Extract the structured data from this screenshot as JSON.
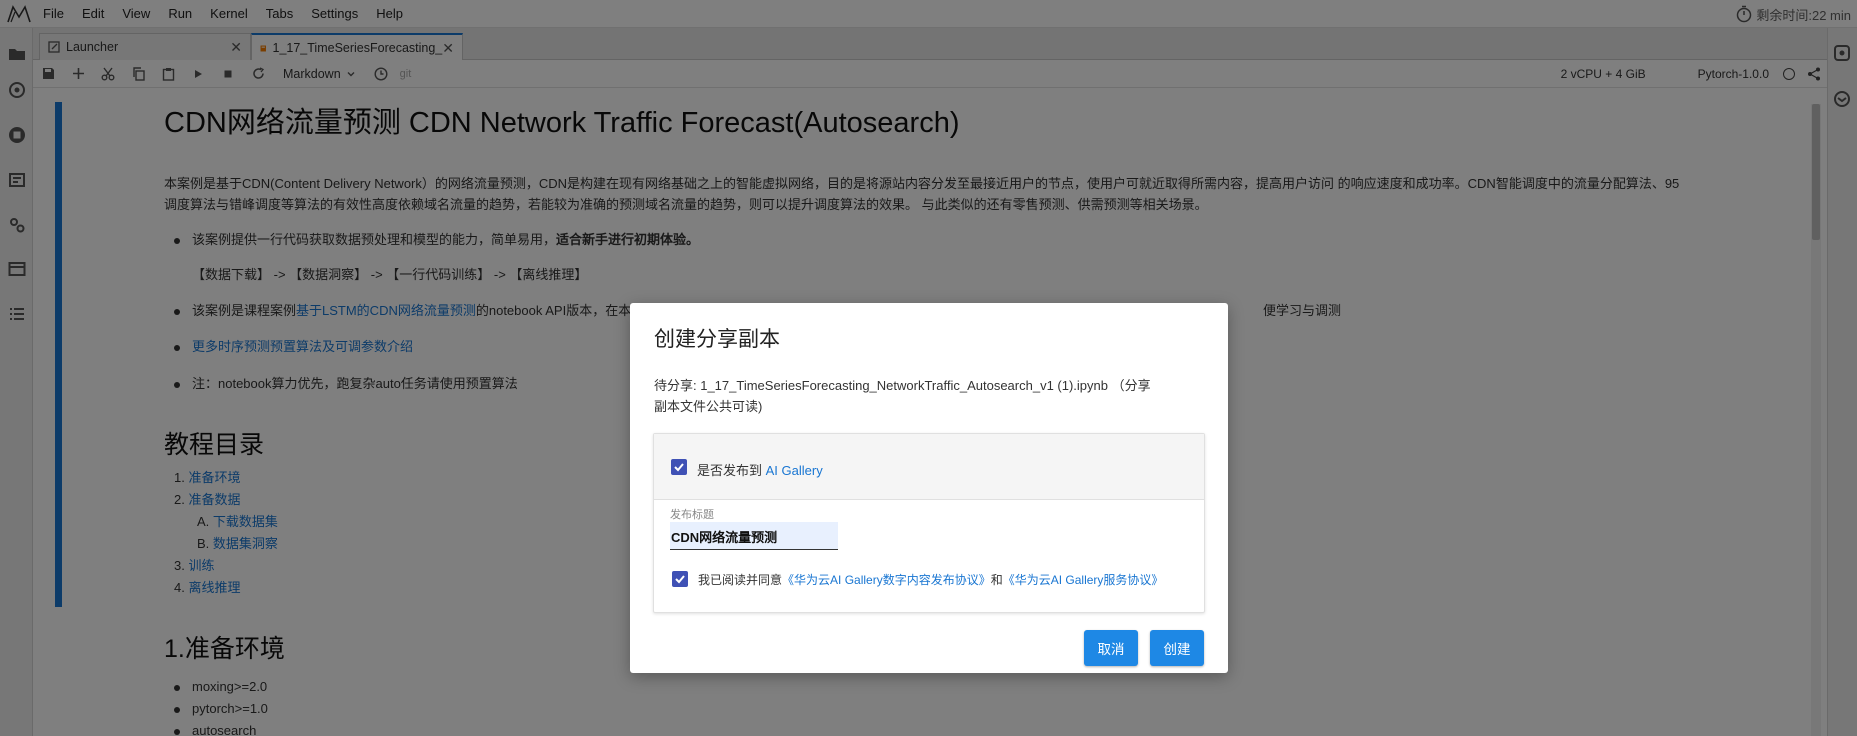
{
  "menubar": {
    "items": [
      "File",
      "Edit",
      "View",
      "Run",
      "Kernel",
      "Tabs",
      "Settings",
      "Help"
    ],
    "timer_label": "剩余时间:22 min"
  },
  "tabs": [
    {
      "label": "Launcher",
      "icon": "launcher-icon"
    },
    {
      "label": "1_17_TimeSeriesForecasting_",
      "icon": "notebook-icon"
    }
  ],
  "toolbar": {
    "cell_type": "Markdown",
    "git_label": "git",
    "resources": "2 vCPU + 4 GiB",
    "kernel": "Pytorch-1.0.0"
  },
  "notebook": {
    "title": "CDN网络流量预测 CDN Network Traffic Forecast(Autosearch)",
    "intro_line1": "本案例是基于CDN(Content Delivery Network）的网络流量预测，CDN是构建在现有网络基础之上的智能虚拟网络，目的是将源站内容分发至最接近用户的节点，使用户可就近取得所需内容，提高用户访问 的响应速度和成功率。CDN智能调度中的流量分配算法、95",
    "intro_line2": "调度算法与错峰调度等算法的有效性高度依赖域名流量的趋势，若能较为准确的预测域名流量的趋势，则可以提升调度算法的效果。 与此类似的还有零售预测、供需预测等相关场景。",
    "bullet1_text": "该案例提供一行代码获取数据预处理和模型的能力，简单易用，",
    "bullet1_bold": "适合新手进行初期体验。",
    "flow": "【数据下载】 -> 【数据洞察】 -> 【一行代码训练】 -> 【离线推理】",
    "bullet2_prefix": "该案例是课程案例",
    "bullet2_link": "基于LSTM的CDN网络流量预测",
    "bullet2_suffix": "的notebook API版本，在本",
    "bullet2_tail": "便学习与调测",
    "bullet3_link": "更多时序预测预置算法及可调参数介绍",
    "bullet4": "注：notebook算力优先，跑复杂auto任务请使用预置算法",
    "toc_title": "教程目录",
    "toc": [
      {
        "num": "1.",
        "label": "准备环境"
      },
      {
        "num": "2.",
        "label": "准备数据"
      },
      {
        "num": "A.",
        "label": "下载数据集"
      },
      {
        "num": "B.",
        "label": "数据集洞察"
      },
      {
        "num": "3.",
        "label": "训练"
      },
      {
        "num": "4.",
        "label": "离线推理"
      }
    ],
    "section1_title": "1.准备环境",
    "requirements": [
      "moxing>=2.0",
      "pytorch>=1.0",
      "autosearch"
    ]
  },
  "dialog": {
    "title": "创建分享副本",
    "desc_line1": "待分享: 1_17_TimeSeriesForecasting_NetworkTraffic_Autosearch_v1 (1).ipynb （分享",
    "desc_line2": "副本文件公共可读)",
    "publish_label": "是否发布到 ",
    "publish_link": "AI Gallery",
    "title_field_label": "发布标题",
    "title_field_value": "CDN网络流量预测",
    "agree_prefix": "我已阅读并同意",
    "agree_link1": "《华为云AI Gallery数字内容发布协议》",
    "agree_and": "和",
    "agree_link2": "《华为云AI Gallery服务协议》",
    "cancel_label": "取消",
    "create_label": "创建"
  },
  "colors": {
    "accent": "#1976d2",
    "button": "#1e88e5",
    "checkbox": "#3f51b5"
  }
}
